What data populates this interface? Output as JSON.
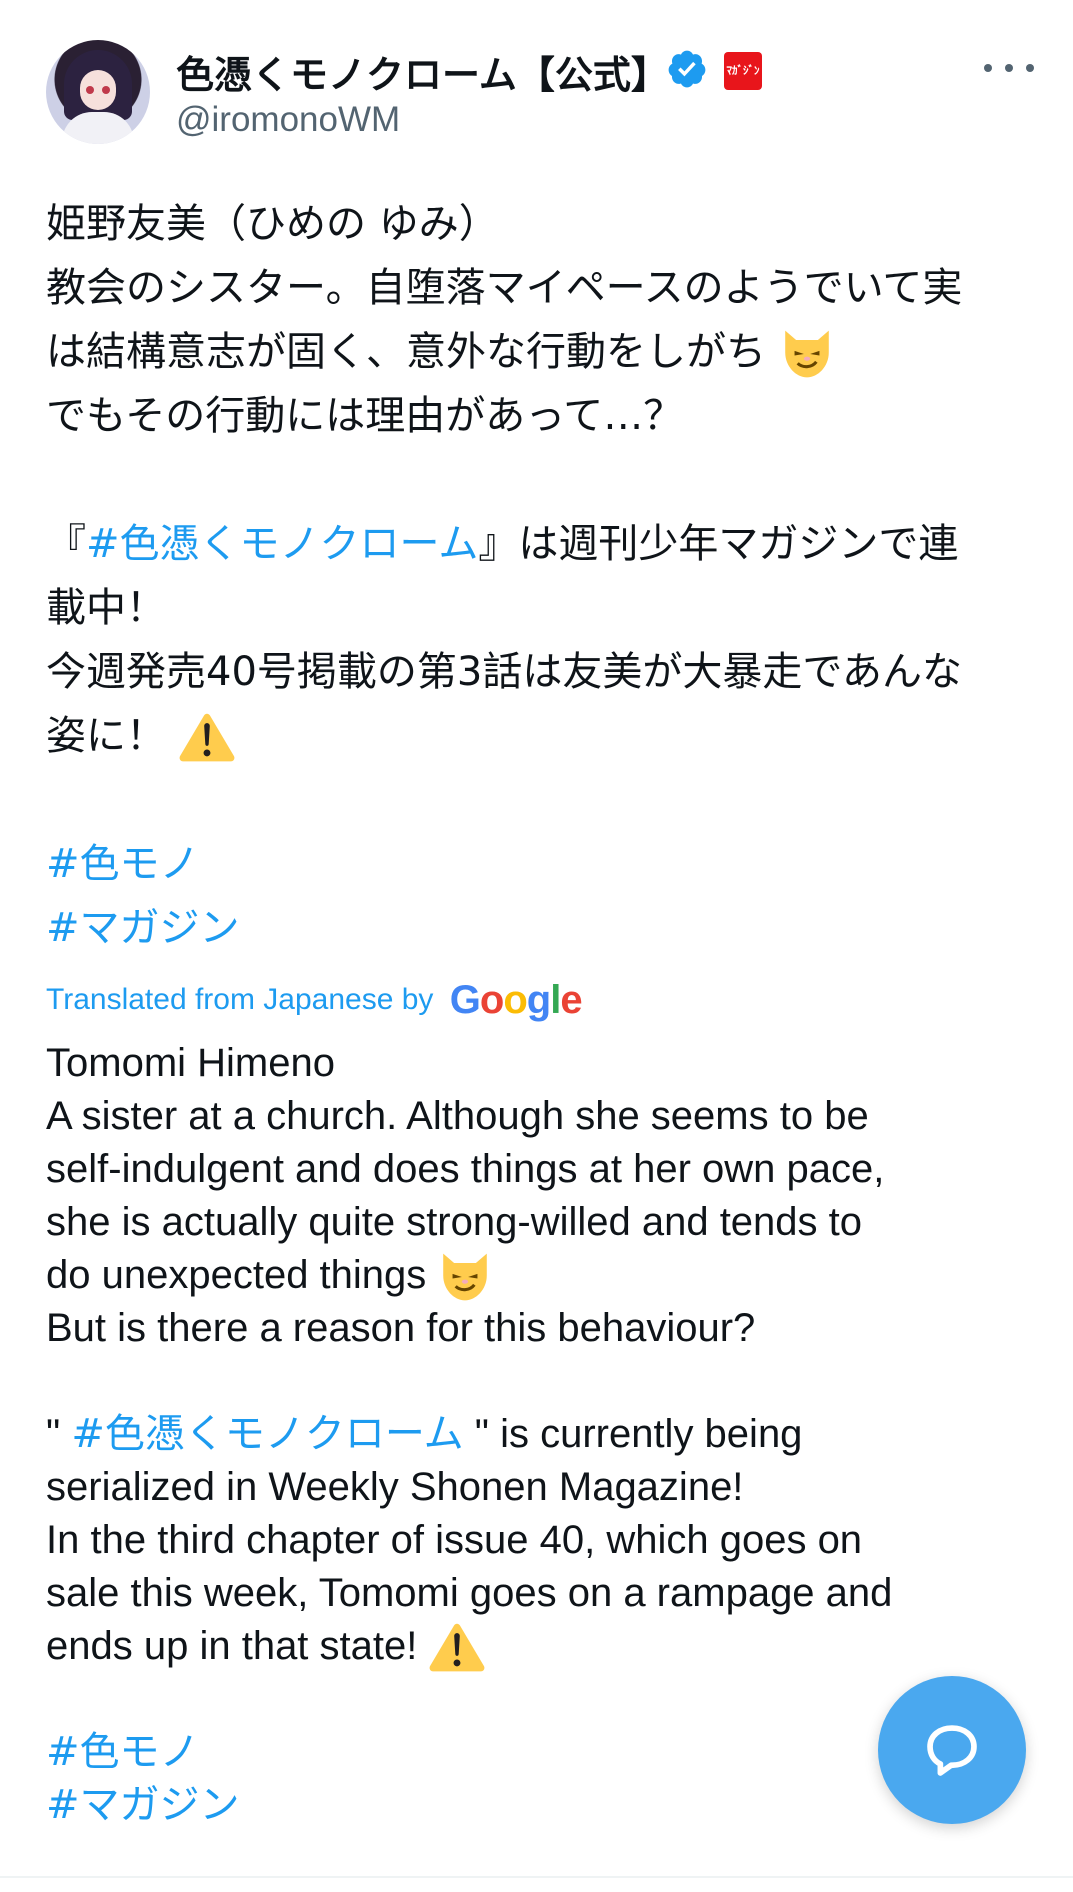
{
  "author": {
    "display_name": "色憑くモノクローム【公式】",
    "handle": "@iromonoWM",
    "magazine_badge": "ﾏｶﾞｼﾞﾝ"
  },
  "tweet_ja": {
    "line1": "姫野友美（ひめの ゆみ）",
    "line2": "教会のシスター。自堕落マイペースのようでいて実",
    "line3": "は結構意志が固く、意外な行動をしがち",
    "line4": "でもその行動には理由があって…？",
    "line5_pre": "『",
    "line5_tag": "#色憑くモノクローム",
    "line5_post": "』は週刊少年マガジンで連",
    "line6": "載中！",
    "line7": "今週発売40号掲載の第3話は友美が大暴走であんな",
    "line8": "姿に！",
    "tag1": "#色モノ",
    "tag2": "#マガジン"
  },
  "translation": {
    "label": "Translated from Japanese by",
    "google": [
      "G",
      "o",
      "o",
      "g",
      "l",
      "e"
    ],
    "line1": "Tomomi Himeno",
    "line2": "A sister at a church. Although she seems to be",
    "line3": "self-indulgent and does things at her own pace,",
    "line4": "she is actually quite strong-willed and tends to",
    "line5": "do unexpected things",
    "line6": "But is there a reason for this behaviour?",
    "line7_pre": "\" ",
    "line7_tag": "#色憑くモノクローム",
    "line7_post": " \" is currently being",
    "line8": "serialized in Weekly Shonen Magazine!",
    "line9": "In the third chapter of issue 40, which goes on",
    "line10": "sale this week, Tomomi goes on a rampage and",
    "line11": "ends up in that state!",
    "tag1": "#色モノ",
    "tag2": "#マガジン"
  },
  "icons": [
    "verified-badge-icon",
    "more-options-icon",
    "smirk-cat-emoji",
    "warning-emoji",
    "reply-compose-icon"
  ],
  "colors": {
    "link": "#1d9bf0",
    "fab": "#4aa8ef",
    "handle": "#536471",
    "text": "#0f1419"
  }
}
